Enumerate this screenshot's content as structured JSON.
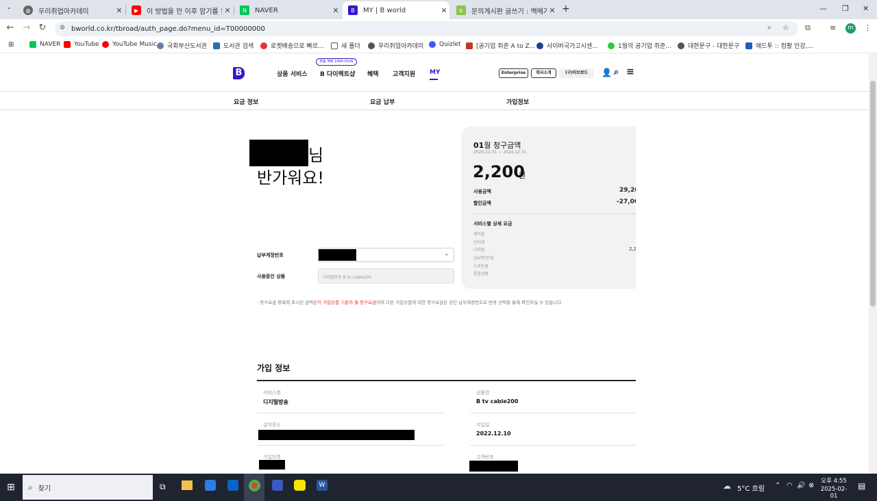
{
  "browser": {
    "tabs": [
      {
        "title": "우리취업아카데미"
      },
      {
        "title": "이 방법을 안 이후 암기를 못하..."
      },
      {
        "title": "NAVER"
      },
      {
        "title": "MY | B world"
      },
      {
        "title": "문의게시판 글쓰기 : 백메가"
      }
    ],
    "new_tab": "+",
    "url": "bworld.co.kr/tbroad/auth_page.do?menu_id=T00000000",
    "profile_initial": "m",
    "bookmarks": [
      "NAVER",
      "YouTube",
      "YouTube Music",
      "국회부산도서관",
      "도서관 검색",
      "로켓배송으로 빠르...",
      "새 폴더",
      "우리취업아카데미",
      "Quizlet",
      "[공기업 취준 A to Z...",
      "사이버국가고시센...",
      "1월의 공기업 취준...",
      "대한문구 - 대한문구",
      "애드투 :: 컴활 인강,..."
    ]
  },
  "site": {
    "logo": "B",
    "nav": [
      "상품 서비스",
      "B 다이렉트샵",
      "혜택",
      "고객지원",
      "MY"
    ],
    "direct_badge": "맞춤 혜택 1600-0106",
    "header_buttons": [
      "Enterprise",
      "회사소개",
      "(구)티브로드"
    ],
    "subnav": [
      "요금 정보",
      "요금 납부",
      "가입정보"
    ],
    "greeting_suffix": "님",
    "greeting": "반가워요!",
    "payment_account_label": "납부계정번호",
    "product_label": "사용중인 상품",
    "product_value": "디지털방송 B tv cable200",
    "notice_prefix": "· 청구요금 항목에 표시된 금액은",
    "notice_highlight": "각 가입상품 기준의 월 청구요금",
    "notice_suffix": "이며 다른 가입상품에 대한 청구요금은 상단 납부계정번호로 변경 선택을 통해 확인하실 수 있습니다.",
    "bill": {
      "month": "01",
      "month_suffix": "월 청구금액",
      "period": "2024.12.01 ~ 2024.12.31",
      "amount": "2,200",
      "unit": "원",
      "usage_label": "사용금액",
      "usage_value": "29,20",
      "discount_label": "할인금액",
      "discount_value": "-27,00",
      "detail_title": "서비스별 상세 요금",
      "details": [
        "케이블",
        "인터넷",
        "디지털",
        "(DV폰)전화",
        "스마트홈",
        "통합상품"
      ],
      "digital_value": "2,2"
    },
    "join_info": {
      "title": "가입 정보",
      "service_label": "서비스명",
      "service_value": "디지털방송",
      "product_label": "상품명",
      "product_value": "B tv cable200",
      "place_label": "설치장소",
      "date_label": "가입일",
      "date_value": "2022.12.10",
      "person_label": "가입자명",
      "customer_label": "고객번호"
    }
  },
  "taskbar": {
    "search": "찾기",
    "weather": "5°C  흐림",
    "time": "오후 4:55",
    "date": "2025-02-01"
  },
  "colors": {
    "brand": "#3617ce",
    "notice_red": "#e8322b"
  }
}
